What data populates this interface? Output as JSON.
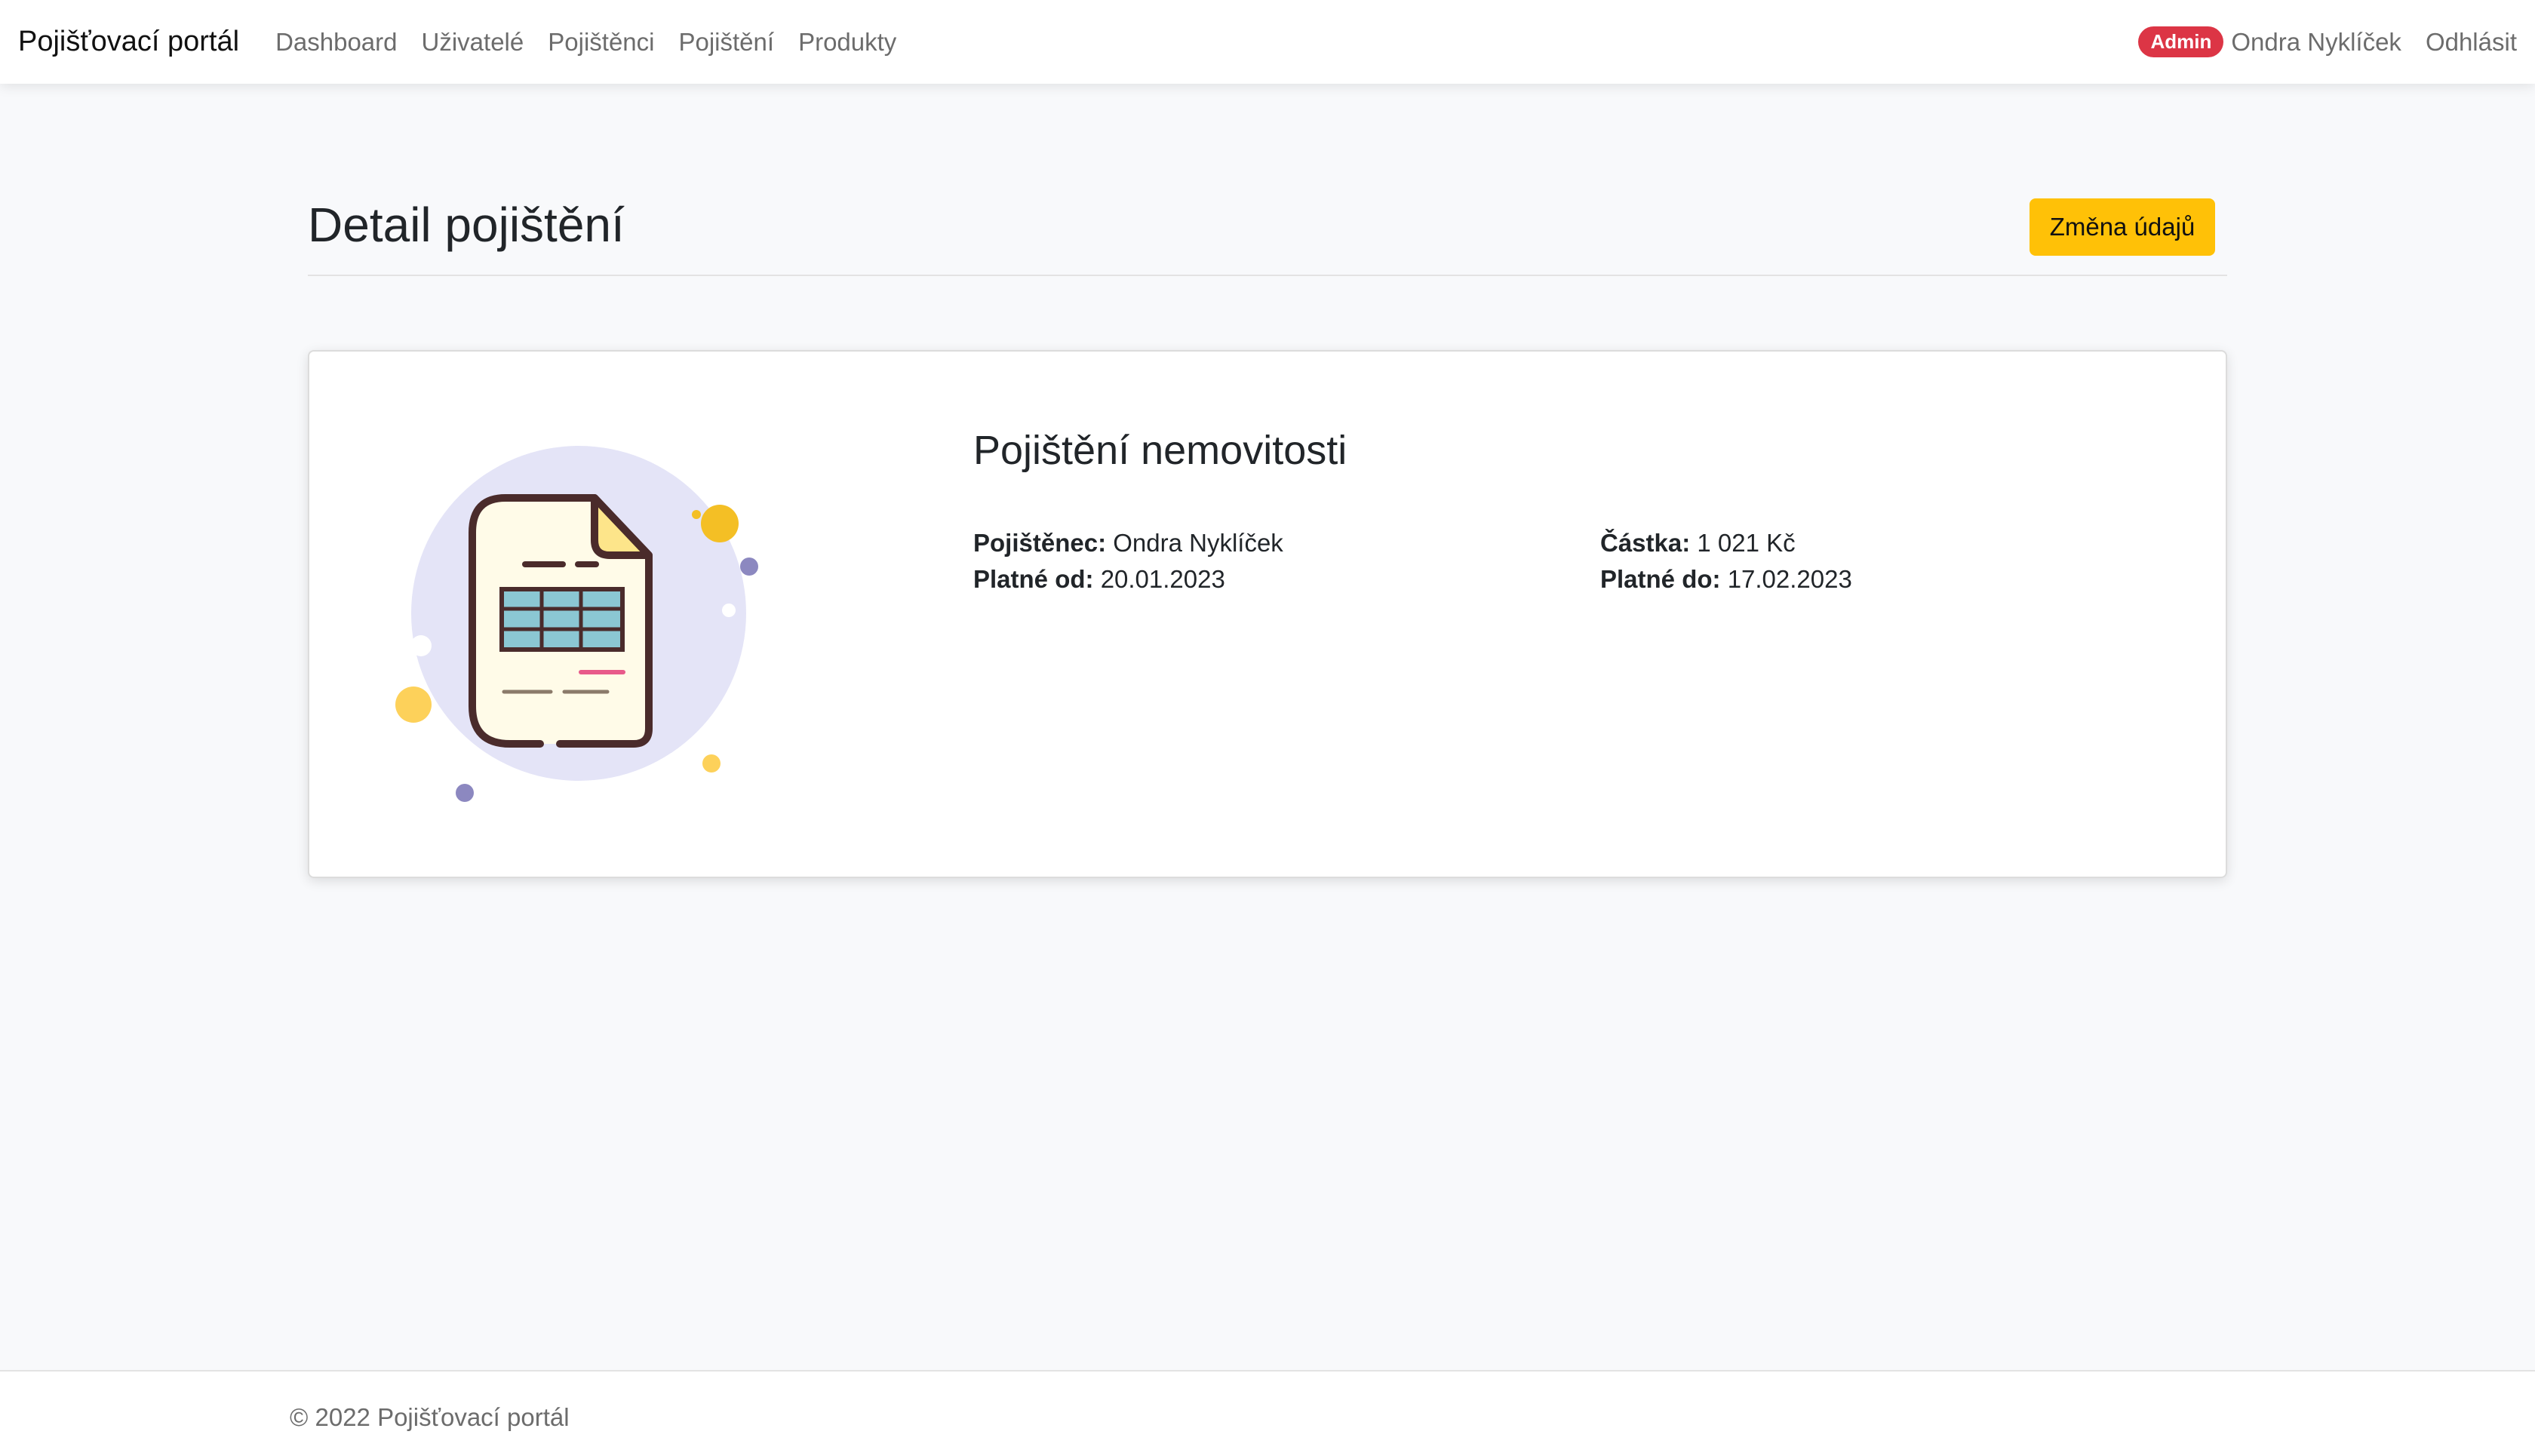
{
  "navbar": {
    "brand": "Pojišťovací portál",
    "links": [
      "Dashboard",
      "Uživatelé",
      "Pojištěnci",
      "Pojištění",
      "Produkty"
    ],
    "badge": "Admin",
    "user": "Ondra Nyklíček",
    "logout": "Odhlásit"
  },
  "page": {
    "title": "Detail pojištění",
    "edit_button": "Změna údajů"
  },
  "card": {
    "illustration_icon": "document-spreadsheet-icon",
    "product_name": "Pojištění nemovitosti",
    "fields": {
      "insured_label": "Pojištěnec:",
      "insured_value": "Ondra Nyklíček",
      "valid_from_label": "Platné od:",
      "valid_from_value": "20.01.2023",
      "amount_label": "Částka:",
      "amount_value": "1 021 Kč",
      "valid_to_label": "Platné do:",
      "valid_to_value": "17.02.2023"
    }
  },
  "footer": {
    "text": "© 2022 Pojišťovací portál"
  },
  "colors": {
    "accent_button": "#ffc107",
    "badge": "#dc3545"
  }
}
